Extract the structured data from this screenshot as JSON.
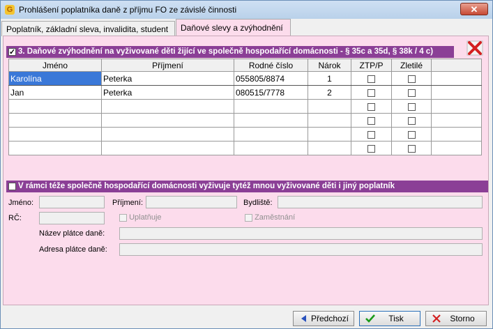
{
  "window": {
    "title": "Prohlášení poplatníka daně z příjmu FO ze závislé činnosti",
    "close_symbol": "✕",
    "app_icon_letter": "G"
  },
  "tabs": [
    {
      "label": "Poplatník, základní sleva, invalidita, student",
      "active": false
    },
    {
      "label": "Daňové  slevy a zvýhodnění",
      "active": true
    }
  ],
  "section1": {
    "checked": true,
    "title": "3. Daňové zvýhodnění na vyživované děti žijící ve společně hospodařící domácnosti - § 35c a 35d, § 38k / 4 c)"
  },
  "table": {
    "headers": [
      "Jméno",
      "Příjmení",
      "Rodné číslo",
      "Nárok",
      "ZTP/P",
      "Zletilé"
    ],
    "rows": [
      {
        "first": "Karolína",
        "last": "Peterka",
        "rc": "055805/8874",
        "narok": "1",
        "ztp": false,
        "zletile": false,
        "selected": true
      },
      {
        "first": "Jan",
        "last": "Peterka",
        "rc": "080515/7778",
        "narok": "2",
        "ztp": false,
        "zletile": false,
        "selected": false
      },
      {
        "first": "",
        "last": "",
        "rc": "",
        "narok": "",
        "ztp": false,
        "zletile": false,
        "selected": false
      },
      {
        "first": "",
        "last": "",
        "rc": "",
        "narok": "",
        "ztp": false,
        "zletile": false,
        "selected": false
      },
      {
        "first": "",
        "last": "",
        "rc": "",
        "narok": "",
        "ztp": false,
        "zletile": false,
        "selected": false
      },
      {
        "first": "",
        "last": "",
        "rc": "",
        "narok": "",
        "ztp": false,
        "zletile": false,
        "selected": false
      }
    ]
  },
  "section2": {
    "checked": false,
    "title": "V rámci téže společně hospodařící domácnosti vyživuje tytéž mnou vyživované děti i jiný poplatník"
  },
  "other_taxpayer": {
    "jmeno_label": "Jméno:",
    "prijmeni_label": "Příjmení:",
    "bydliste_label": "Bydliště:",
    "rc_label": "RČ:",
    "uplatnuje_label": "Uplatňuje",
    "zamestnani_label": "Zaměstnání",
    "nazev_platce_label": "Název plátce daně:",
    "adresa_platce_label": "Adresa plátce daně:"
  },
  "buttons": {
    "prev": "Předchozí",
    "print": "Tisk",
    "cancel": "Storno"
  },
  "colors": {
    "section_bar": "#8b3f96",
    "panel_bg": "#fcdcec",
    "selection": "#3a78d8"
  }
}
